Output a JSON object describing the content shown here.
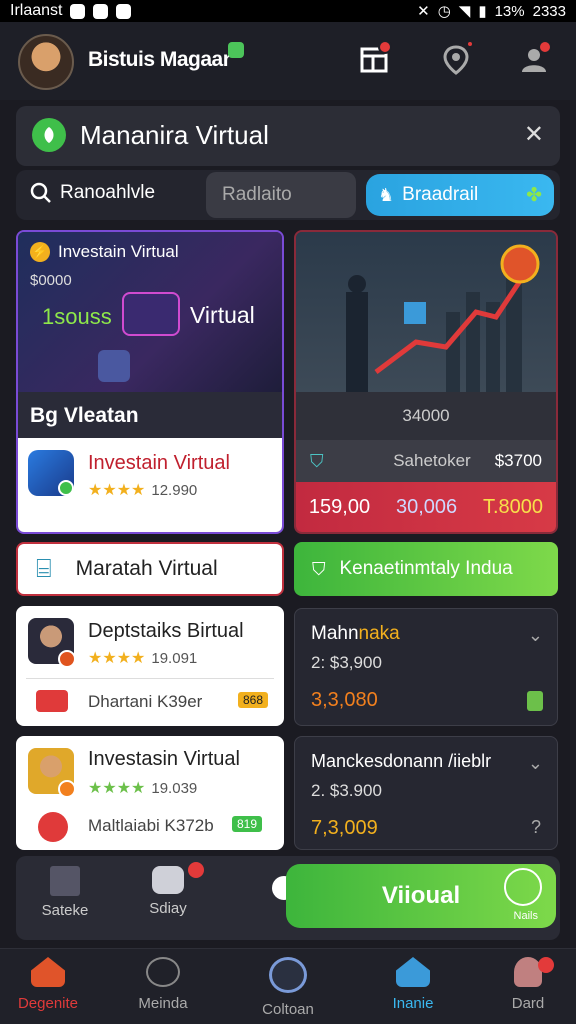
{
  "status_bar": {
    "carrier": "Irlaanst",
    "battery": "13%",
    "time": "2333"
  },
  "header": {
    "username": "Bistuis Magaar"
  },
  "search_card": {
    "title": "Mananira Virtual"
  },
  "filter": {
    "search_label": "Ranoahlvle",
    "input_placeholder": "Radlaito",
    "button_label": "Braadrail"
  },
  "card1": {
    "tag": "Investain Virtual",
    "amount": "$0000",
    "hero_left": "1souss",
    "hero_right": "Virtual",
    "caption": "Bg Vleatan",
    "app_title": "Investain Virtual",
    "rating": "12.990"
  },
  "card2": {
    "amount": "34000",
    "label": "Sahetoker",
    "label_value": "$3700",
    "stats": [
      "159,00",
      "30,006",
      "T.8000"
    ]
  },
  "wide_left": {
    "label": "Maratah Virtual"
  },
  "wide_right": {
    "label": "Kenaetinmtaly Indua"
  },
  "list_left": [
    {
      "title": "Deptstaiks Birtual",
      "rating": "19.091",
      "subtitle": "Dhartani K39er",
      "tag": "868"
    },
    {
      "title": "Investasin Virtual",
      "rating": "19.039",
      "subtitle": "Maltlaiabi K372b",
      "tag": "819"
    }
  ],
  "list_right": [
    {
      "title_a": "Mahn",
      "title_b": "naka",
      "line2": "2: $3,900",
      "value": "3,3,080"
    },
    {
      "title_a": "Manckesdonann /iieblr",
      "title_b": "",
      "line2": "2. $3.900",
      "value": "7,3,009"
    }
  ],
  "action_bar": {
    "item1": "Sateke",
    "item2": "Sdiay",
    "cta": "Viioual",
    "cta_sub": "Nails"
  },
  "bottom_nav": [
    "Degenite",
    "Meinda",
    "Coltoan",
    "Inanie",
    "Dard"
  ]
}
